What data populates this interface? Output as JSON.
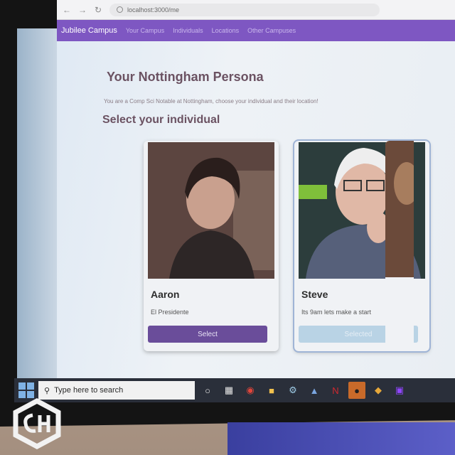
{
  "browser": {
    "url": "localhost:3000/me",
    "back_icon": "arrow-left-icon",
    "forward_icon": "arrow-right-icon",
    "reload_icon": "reload-icon"
  },
  "appbar": {
    "brand": "Jubilee Campus",
    "links": [
      "Your Campus",
      "Individuals",
      "Locations",
      "Other Campuses"
    ]
  },
  "page": {
    "title": "Your Nottingham Persona",
    "subtitle": "You are a Comp Sci Notable at Nottingham, choose your individual and their location!",
    "section_title": "Select your individual"
  },
  "cards": [
    {
      "name": "Aaron",
      "description": "El Presidente",
      "button_label": "Select",
      "state": "enabled"
    },
    {
      "name": "Steve",
      "description": "Its 9am lets make a start",
      "button_label": "Selected",
      "state": "selected"
    }
  ],
  "taskbar": {
    "search_placeholder": "Type here to search",
    "icons": [
      "cortana-icon",
      "task-view-icon",
      "chrome-icon",
      "file-explorer-icon",
      "steam-icon",
      "app-icon",
      "netflix-icon",
      "spotify-icon",
      "git-icon",
      "twitch-icon"
    ]
  },
  "colors": {
    "appbar": "#7e57c2",
    "primary_button": "#6a4d9a",
    "disabled_button": "#b9d3e5",
    "title": "#6b5262"
  }
}
